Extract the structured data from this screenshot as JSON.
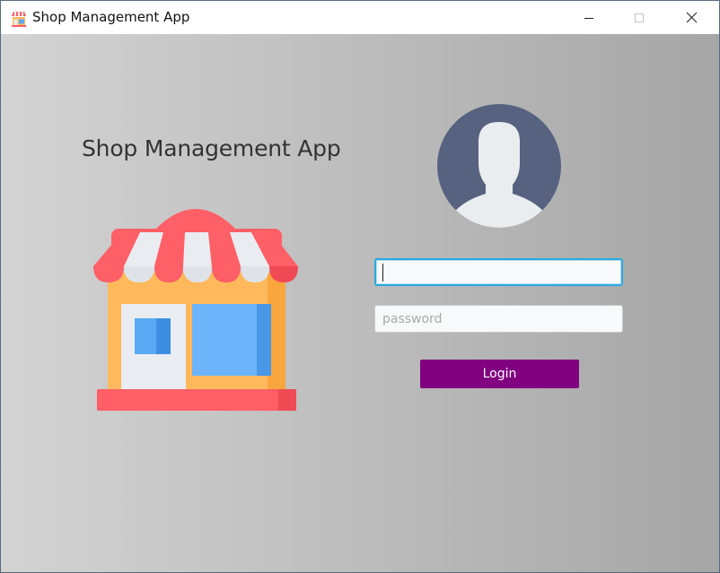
{
  "window": {
    "title": "Shop Management App",
    "icon": "shop-icon",
    "controls": [
      "minimize-icon",
      "maximize-icon",
      "close-icon"
    ]
  },
  "main": {
    "heading": "Shop Management App",
    "illustration": "storefront-icon",
    "avatar": "user-avatar-icon"
  },
  "login_form": {
    "username_value": "",
    "username_placeholder": "",
    "password_value": "",
    "password_placeholder": "password",
    "login_label": "Login"
  },
  "colors": {
    "background_left": "#d3d3d3",
    "background_right": "#a6a6a6",
    "login_button": "#800080",
    "focus_border": "#2aa9e0",
    "avatar_bg": "#56627f"
  }
}
